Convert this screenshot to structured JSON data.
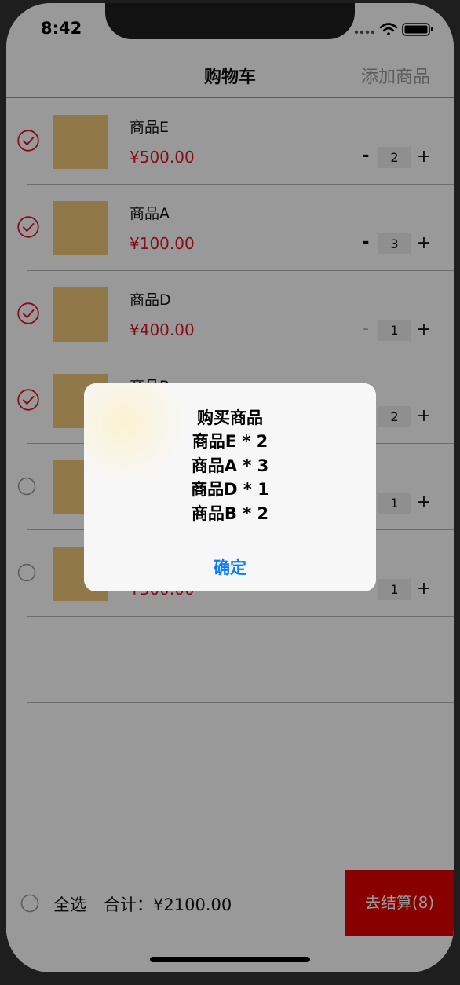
{
  "status_bar": {
    "time": "8:42"
  },
  "nav": {
    "title": "购物车",
    "action": "添加商品"
  },
  "items": [
    {
      "name": "商品E",
      "price": "¥500.00",
      "quantity": "2",
      "selected": true
    },
    {
      "name": "商品A",
      "price": "¥100.00",
      "quantity": "3",
      "selected": true
    },
    {
      "name": "商品D",
      "price": "¥400.00",
      "quantity": "1",
      "selected": true
    },
    {
      "name": "商品B",
      "price": "",
      "quantity": "2",
      "selected": true
    },
    {
      "name": "",
      "price": "",
      "quantity": "1",
      "selected": false
    },
    {
      "name": "",
      "price": "¥300.00",
      "quantity": "1",
      "selected": false
    }
  ],
  "footer": {
    "select_all": "全选",
    "total": "合计：¥2100.00",
    "checkout": "去结算(8)"
  },
  "dialog": {
    "title": "购买商品",
    "lines": [
      "商品E * 2",
      "商品A * 3",
      "商品D * 1",
      "商品B * 2"
    ],
    "confirm": "确定"
  },
  "colors": {
    "price": "#e0132e",
    "check_selected": "#e0132e",
    "checkout_bg": "#e30000",
    "confirm_text": "#0a7aff",
    "thumbnail": "#f0c87a"
  },
  "icons": {
    "checked": "check-circle-icon",
    "unchecked": "empty-circle-icon",
    "signal": "cellular-signal-icon",
    "wifi": "wifi-icon",
    "battery": "battery-icon"
  }
}
